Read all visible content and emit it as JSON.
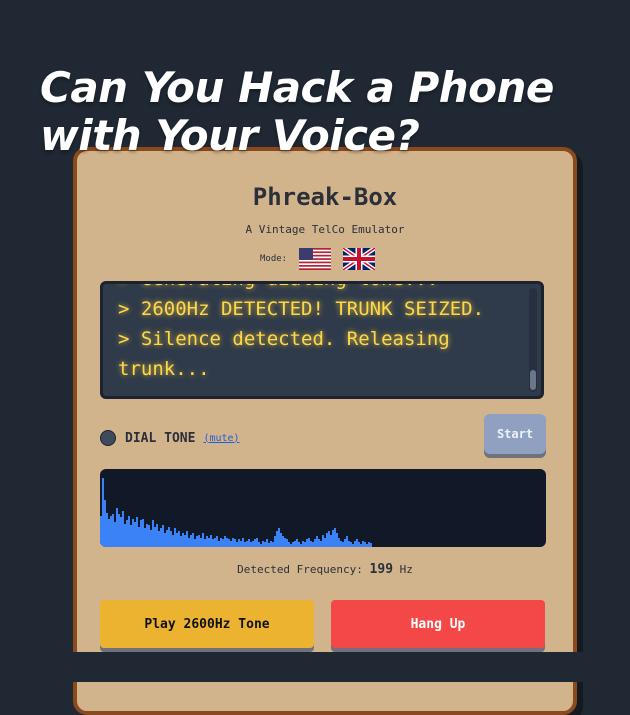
{
  "page": {
    "title": "Can You Hack a Phone with Your Voice?"
  },
  "device": {
    "name": "Phreak-Box",
    "subtitle": "A Vintage TelCo Emulator",
    "mode_label": "Mode:",
    "modes": [
      "us-flag-icon",
      "uk-flag-icon"
    ]
  },
  "terminal": {
    "lines": [
      "> Generating dialing tone...",
      "> 2600Hz DETECTED! TRUNK SEIZED.",
      "> Silence detected. Releasing trunk..."
    ],
    "text_color": "#ffd84a"
  },
  "status": {
    "label": "DIAL TONE",
    "mute_label": "(mute)",
    "start_label": "Start"
  },
  "visualizer": {
    "bar_color": "#3b82f6",
    "levels": [
      0.4,
      0.88,
      0.6,
      0.44,
      0.36,
      0.4,
      0.42,
      0.32,
      0.5,
      0.42,
      0.38,
      0.46,
      0.3,
      0.34,
      0.4,
      0.28,
      0.36,
      0.32,
      0.38,
      0.26,
      0.34,
      0.36,
      0.24,
      0.3,
      0.28,
      0.22,
      0.34,
      0.26,
      0.3,
      0.2,
      0.24,
      0.28,
      0.18,
      0.22,
      0.26,
      0.2,
      0.16,
      0.24,
      0.18,
      0.2,
      0.14,
      0.18,
      0.16,
      0.2,
      0.12,
      0.16,
      0.18,
      0.1,
      0.14,
      0.16,
      0.12,
      0.18,
      0.1,
      0.14,
      0.12,
      0.16,
      0.1,
      0.12,
      0.14,
      0.08,
      0.12,
      0.1,
      0.14,
      0.12,
      0.1,
      0.08,
      0.12,
      0.1,
      0.06,
      0.1,
      0.08,
      0.12,
      0.06,
      0.08,
      0.1,
      0.06,
      0.08,
      0.1,
      0.12,
      0.06,
      0.04,
      0.08,
      0.06,
      0.1,
      0.05,
      0.08,
      0.06,
      0.14,
      0.2,
      0.24,
      0.18,
      0.14,
      0.12,
      0.1,
      0.06,
      0.04,
      0.06,
      0.08,
      0.1,
      0.06,
      0.04,
      0.08,
      0.06,
      0.1,
      0.12,
      0.08,
      0.06,
      0.1,
      0.14,
      0.1,
      0.08,
      0.16,
      0.12,
      0.18,
      0.2,
      0.16,
      0.22,
      0.24,
      0.18,
      0.12,
      0.08,
      0.06,
      0.1,
      0.14,
      0.08,
      0.06,
      0.04,
      0.08,
      0.1,
      0.06,
      0.04,
      0.08,
      0.06,
      0.04,
      0.06,
      0.05
    ]
  },
  "frequency": {
    "label": "Detected Frequency:",
    "value": "199",
    "unit": "Hz"
  },
  "buttons": {
    "play": "Play 2600Hz Tone",
    "hangup": "Hang Up"
  }
}
